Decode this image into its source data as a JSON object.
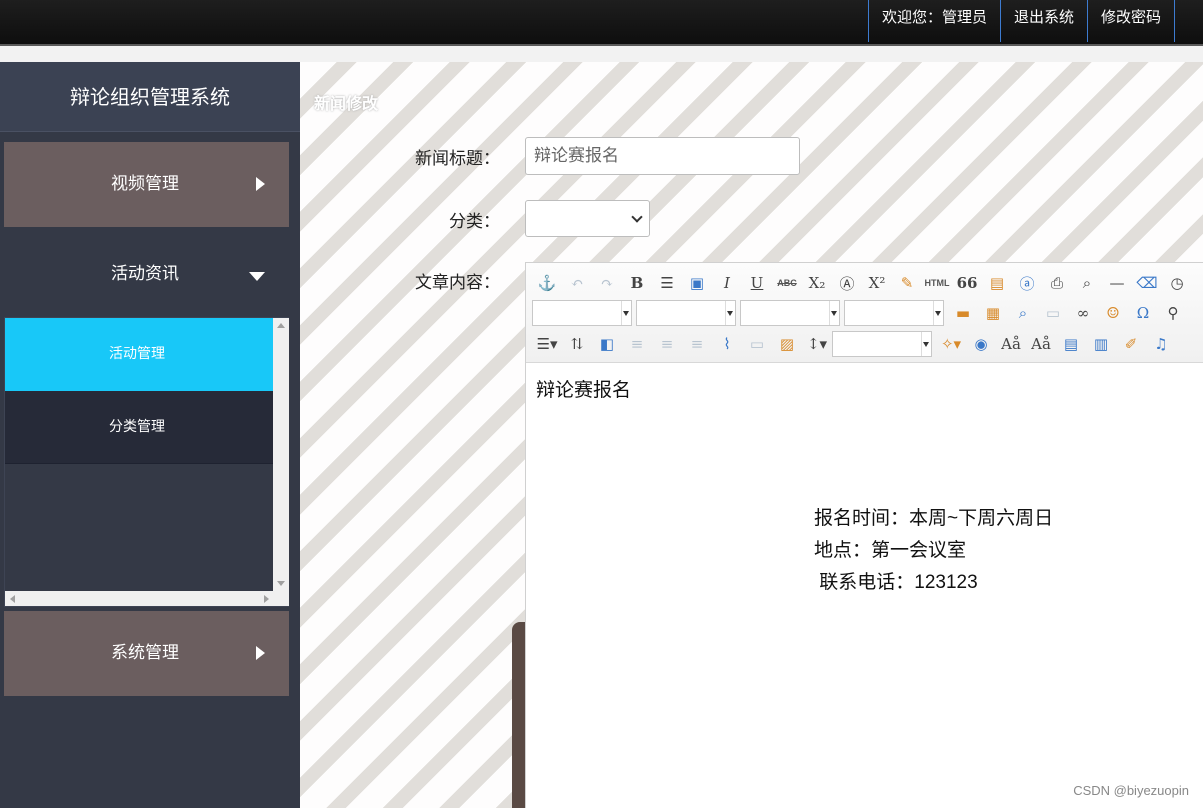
{
  "topnav": {
    "welcome": "欢迎您：管理员",
    "logout": "退出系统",
    "change_password": "修改密码"
  },
  "sidebar": {
    "title": "辩论组织管理系统",
    "menu": {
      "video": "视频管理",
      "activity": "活动资讯",
      "system": "系统管理"
    },
    "submenu": {
      "activity_manage": "活动管理",
      "category_manage": "分类管理"
    }
  },
  "main": {
    "breadcrumb": "新闻修改",
    "form": {
      "title_label": "新闻标题：",
      "title_value": "辩论赛报名",
      "category_label": "分类：",
      "category_value": "",
      "content_label": "文章内容："
    },
    "editor": {
      "toolbar_icons": {
        "bold": "B",
        "italic": "I",
        "underline": "U",
        "strikethrough": "ABC",
        "subscript": "X₂",
        "superscript": "X²",
        "html": "HTML",
        "quote": "66",
        "omega": "Ω"
      },
      "content_first": "辩论赛报名",
      "content_lines": [
        "报名时间：本周~下周六周日",
        "地点：第一会议室",
        " 联系电话：123123"
      ]
    }
  },
  "watermark": "CSDN @biyezuopin",
  "colors": {
    "topbar": "#111111",
    "sidebar": "#343946",
    "menu_block": "#6b5e5f",
    "active_item": "#18c8f8"
  }
}
